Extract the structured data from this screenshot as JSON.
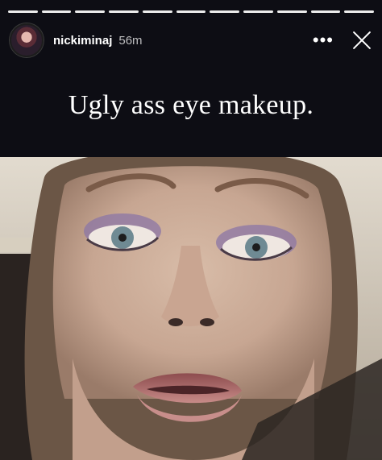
{
  "story": {
    "username": "nickiminaj",
    "timestamp": "56m",
    "caption": "Ugly ass eye makeup.",
    "progress_segments": 11,
    "active_segment": 10
  },
  "icons": {
    "more": "more-horizontal-icon",
    "close": "close-icon"
  },
  "colors": {
    "background": "#0d0d14",
    "text": "#ffffff"
  }
}
